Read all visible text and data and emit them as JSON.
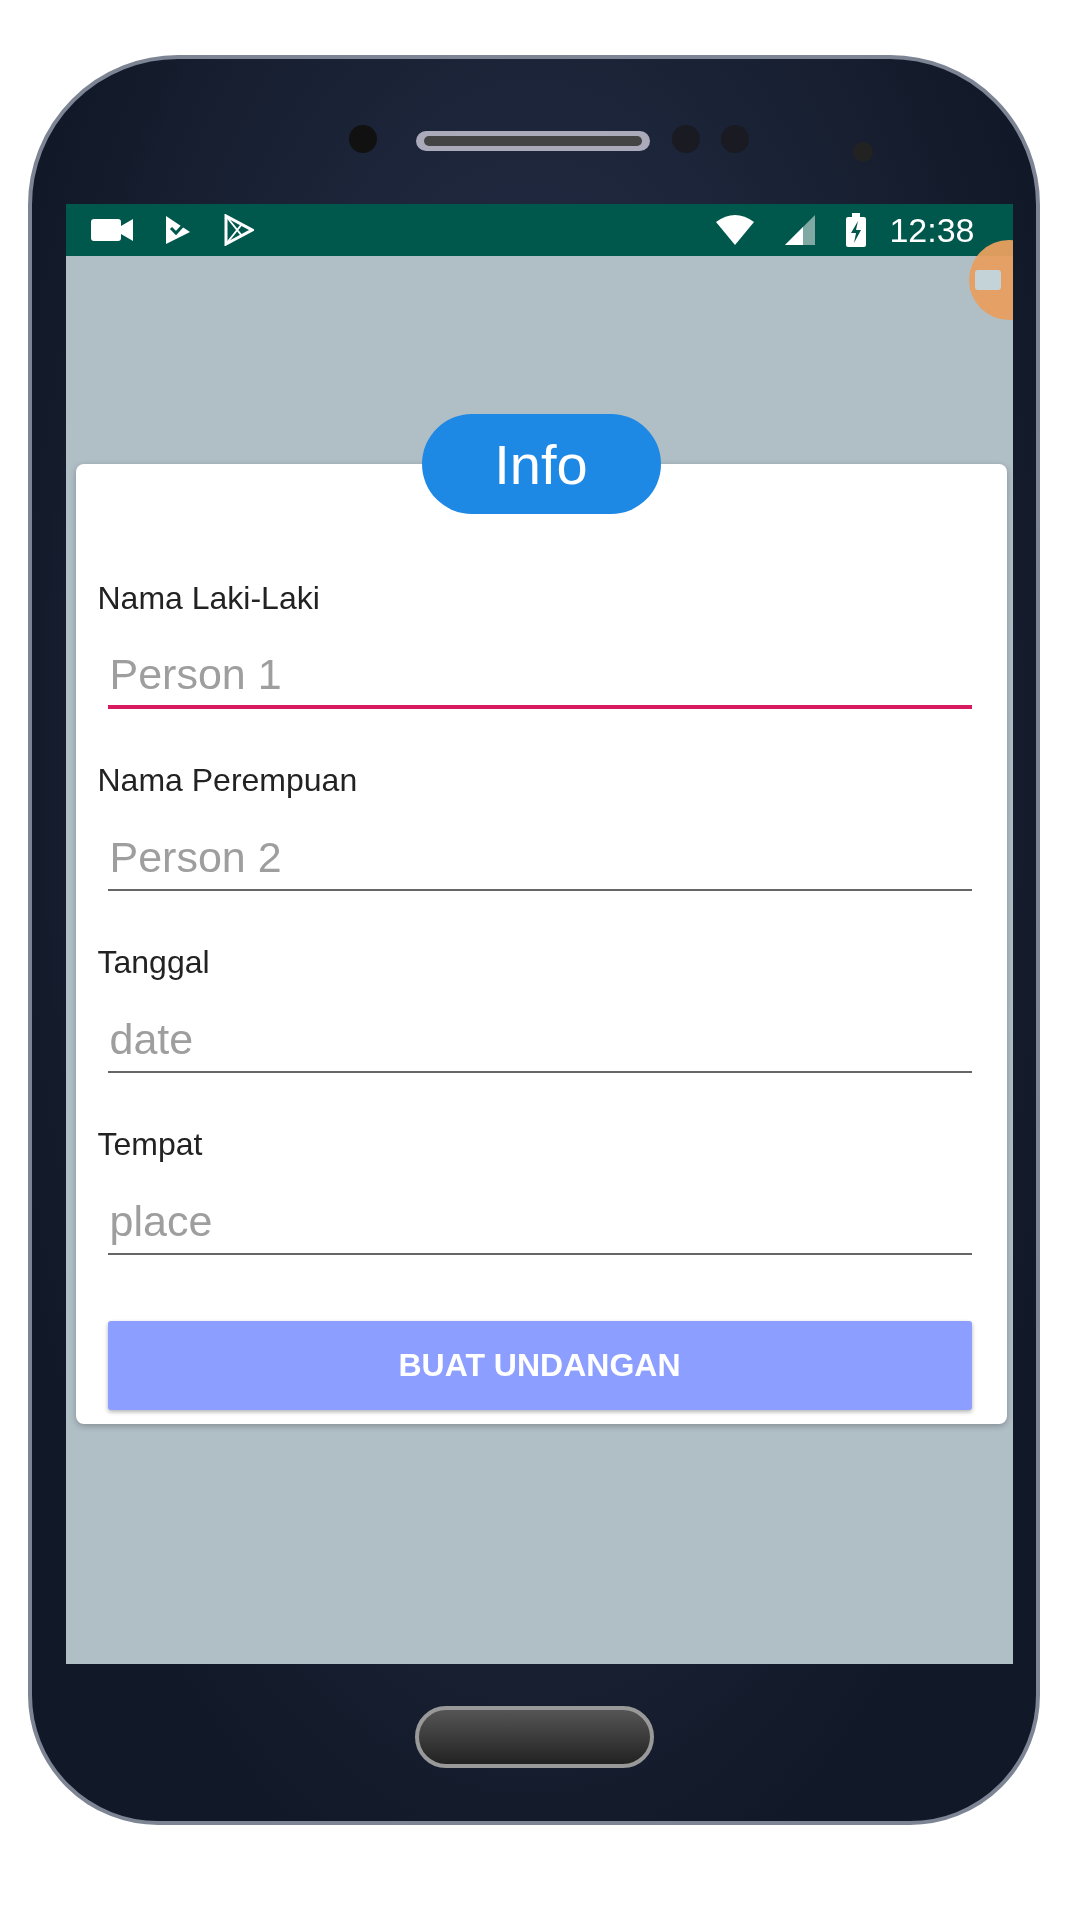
{
  "status_bar": {
    "time": "12:38"
  },
  "dialog": {
    "title": "Info",
    "fields": [
      {
        "label": "Nama Laki-Laki",
        "placeholder": "Person 1",
        "focused": true
      },
      {
        "label": "Nama Perempuan",
        "placeholder": "Person 2",
        "focused": false
      },
      {
        "label": "Tanggal",
        "placeholder": "date",
        "focused": false
      },
      {
        "label": "Tempat",
        "placeholder": "place",
        "focused": false
      }
    ],
    "button": "BUAT UNDANGAN"
  }
}
